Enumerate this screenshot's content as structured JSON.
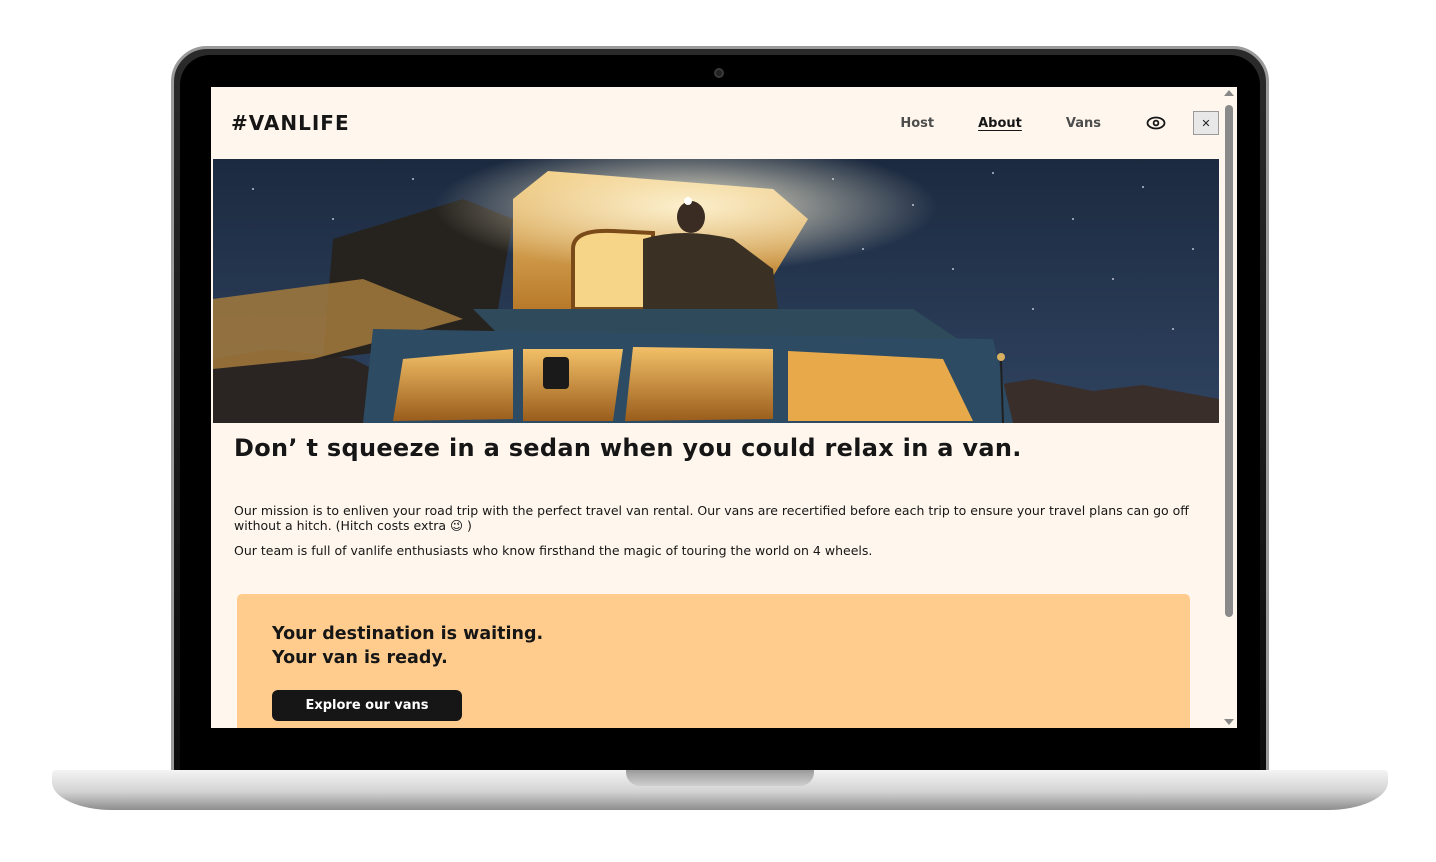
{
  "header": {
    "logo": "#VANLIFE",
    "nav": [
      {
        "label": "Host",
        "active": false
      },
      {
        "label": "About",
        "active": true
      },
      {
        "label": "Vans",
        "active": false
      }
    ],
    "login_icon": "user-circle-icon",
    "close_label": "✕"
  },
  "hero": {
    "image_description_icon": "camper-van-night-photo"
  },
  "about": {
    "heading": "Don’   t squeeze in a sedan when you could relax in a van.",
    "paragraph1": "Our mission is to enliven your road trip with the perfect travel van rental. Our vans are recertified before each trip to ensure your travel plans can go off without a hitch. (Hitch costs extra 😉 )",
    "paragraph2": "Our team is full of vanlife enthusiasts who know firsthand the magic of touring the world on 4 wheels."
  },
  "cta": {
    "line1": "Your destination is waiting.",
    "line2": "Your van is ready.",
    "button_label": "Explore our vans"
  },
  "colors": {
    "page_bg": "#fff7ed",
    "cta_bg": "#ffcc8d",
    "text": "#161616",
    "button_bg": "#161616"
  }
}
